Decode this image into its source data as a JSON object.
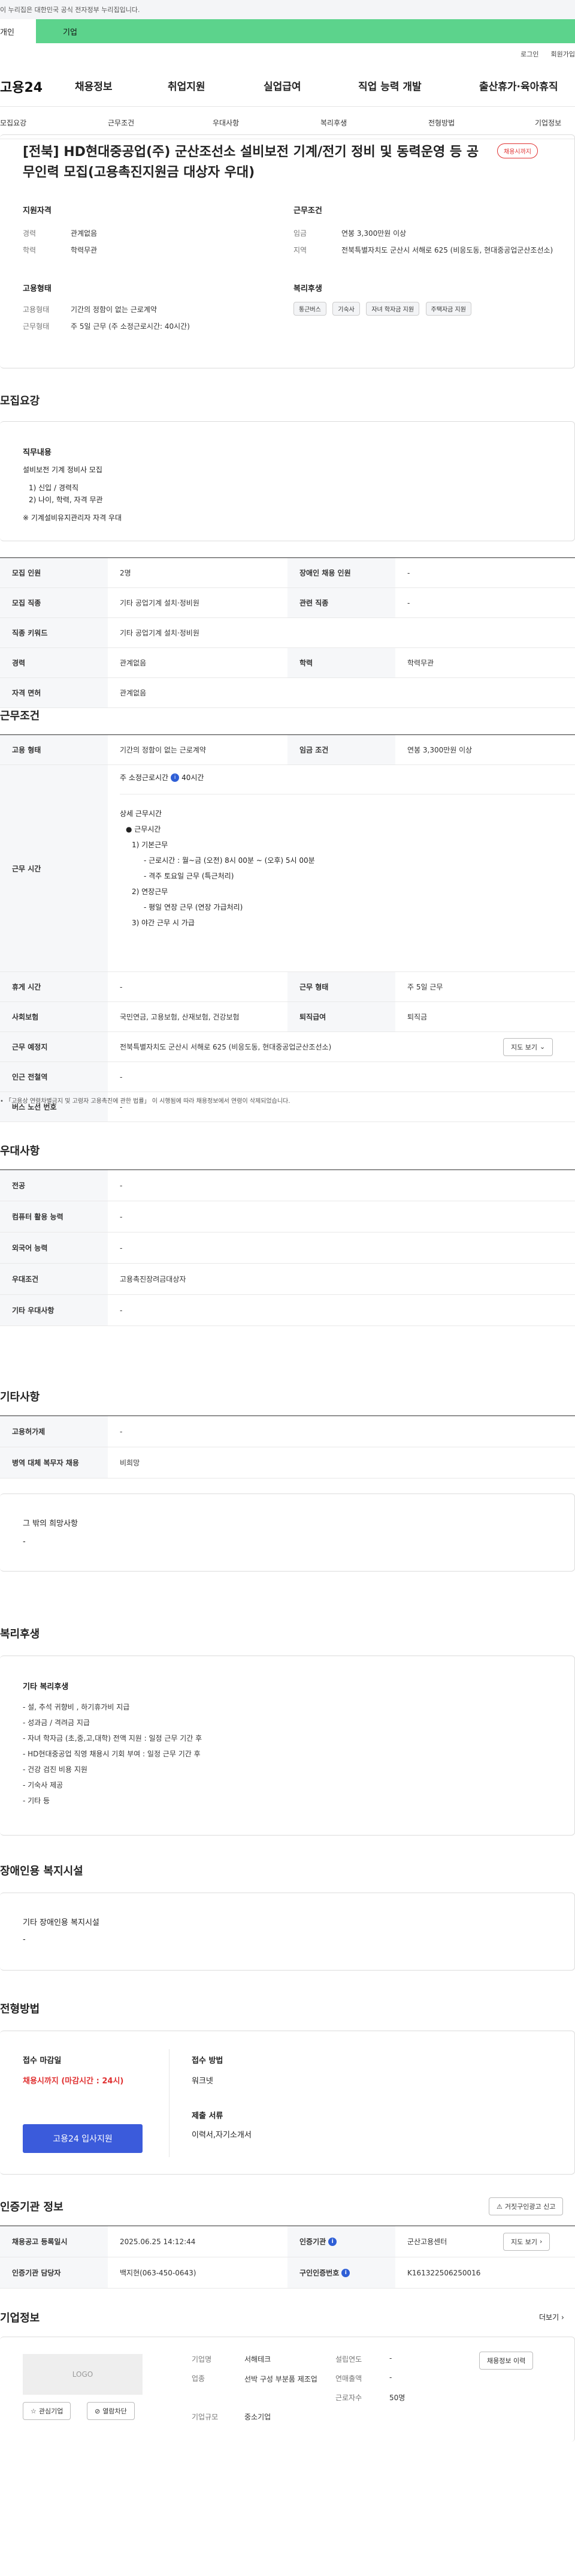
{
  "gov_banner": "이 누리집은 대한민국 공식 전자정부 누리집입니다.",
  "top_tabs": [
    "개인",
    "기업"
  ],
  "util": [
    "로그인",
    "회원가입"
  ],
  "logo": "고용24",
  "gnb": [
    "채용정보",
    "취업지원",
    "실업급여",
    "직업 능력 개발",
    "출산휴가·육아휴직"
  ],
  "lnb": [
    "모집요강",
    "근무조건",
    "우대사항",
    "복리후생",
    "전형방법",
    "기업정보"
  ],
  "header": {
    "title": "[전북] HD현대중공업(주) 군산조선소 설비보전 기계/전기 정비 및 동력운영 등 공무인력 모집(고용촉진지원금 대상자 우대)",
    "status": "채용시까지",
    "applicant_title": "지원자격",
    "applicant": [
      [
        "경력",
        "관계없음"
      ],
      [
        "학력",
        "학력무관"
      ]
    ],
    "emp_title": "고용형태",
    "emp": [
      [
        "고용형태",
        "기간의 정함이 없는 근로계약"
      ],
      [
        "근무형태",
        "주 5일 근무 (주 소정근로시간: 40시간)"
      ]
    ],
    "cond_title": "근무조건",
    "cond": [
      [
        "임금",
        "연봉 3,300만원 이상"
      ],
      [
        "지역",
        "전북특별자치도 군산시 서해로 625 (비응도동, 현대중공업군산조선소)"
      ]
    ],
    "welfare_title": "복리후생",
    "welfare_chips": [
      "통근버스",
      "기숙사",
      "자녀 학자금 지원",
      "주택자금 지원"
    ]
  },
  "recruit": {
    "title": "모집요강",
    "duty_label": "직무내용",
    "duty_lines": [
      "설비보전 기계 정비사 모집",
      "",
      "1) 신입 / 경력직",
      "2) 나이, 학력, 자격 무관",
      "",
      "※ 기계설비유지관리자 자격 우대"
    ],
    "rows": [
      [
        "모집 인원",
        "2명",
        "장애인 채용 인원",
        "-"
      ],
      [
        "모집 직종",
        "기타 공업기계 설치·정비원",
        "관련 직종",
        "-"
      ],
      [
        "직종 키워드",
        "기타 공업기계 설치·정비원",
        "",
        ""
      ],
      [
        "경력",
        "관계없음",
        "학력",
        "학력무관"
      ],
      [
        "자격 면허",
        "관계없음",
        "",
        ""
      ]
    ]
  },
  "work": {
    "title": "근무조건",
    "row1": [
      "고용 형태",
      "기간의 정함이 없는 근로계약",
      "임금 조건",
      "연봉 3,300만원 이상"
    ],
    "time_label": "근무 시간",
    "time_top": "주 소정근로시간",
    "time_hours": "40시간",
    "time_lines": [
      "상세 근무시간",
      "● 근무시간",
      "1) 기본근무",
      "- 근로시간 : 월~금 (오전) 8시 00분 ~ (오후) 5시 00분",
      "- 격주 토요일 근무 (특근처리)",
      "2) 연장근무",
      "- 평일 연장 근무 (연장 가급처리)",
      "3) 야간 근무 시 가급"
    ],
    "row3": [
      "휴게 시간",
      "-",
      "근무 형태",
      "주 5일 근무"
    ],
    "row4": [
      "사회보험",
      "국민연금, 고용보험, 산재보험, 건강보험",
      "퇴직급여",
      "퇴직금"
    ],
    "loc_label": "근무 예정지",
    "loc_value": "전북특별자치도 군산시 서해로 625 (비응도동, 현대중공업군산조선소)",
    "map_btn": "지도 보기",
    "row6": [
      "인근 전철역",
      "-"
    ],
    "row7": [
      "버스 노선 번호",
      "-"
    ],
    "note": "「고용상 연령차별금지 및 고령자 고용촉진에 관한 법률」 이 시행됨에 따라 채용정보에서 연령이 삭제되었습니다."
  },
  "prefer": {
    "title": "우대사항",
    "rows": [
      [
        "전공",
        "-"
      ],
      [
        "컴퓨터 활용 능력",
        "-"
      ],
      [
        "외국어 능력",
        "-"
      ],
      [
        "우대조건",
        "고용촉진장려금대상자"
      ],
      [
        "기타 우대사항",
        "-"
      ]
    ]
  },
  "etc": {
    "title": "기타사항",
    "rows": [
      [
        "고용허가제",
        "-"
      ],
      [
        "병역 대체 복무자 채용",
        "비희망"
      ]
    ],
    "other_title": "그 밖의 희망사항",
    "other_value": "-"
  },
  "benefit": {
    "title": "복리후생",
    "box_title": "기타 복리후생",
    "lines": [
      "- 설, 추석 귀향비 , 하기휴가비 지급",
      "- 성과금 / 격려금 지급",
      "- 자녀 학자금 (초,중,고,대학) 전액 지원 : 일정 근무 기간 후",
      "- HD현대중공업 직영 채용시 기회 부여 : 일정 근무 기간 후",
      "- 건강 검진 비용 지원",
      "- 기숙사 제공",
      "- 기타 등"
    ]
  },
  "disabled": {
    "title": "장애인용 복지시설",
    "box_title": "기타 장애인용 복지시설",
    "value": "-"
  },
  "selection": {
    "title": "전형방법",
    "deadline_label": "접수 마감일",
    "deadline_value": "채용시까지 (마감시간 : 24시)",
    "apply_btn": "고용24 입사지원",
    "method_label": "접수 방법",
    "method_value": "워크넷",
    "docs_label": "제출 서류",
    "docs_value": "이력서,자기소개서"
  },
  "agency": {
    "title": "인증기관 정보",
    "report_btn": "거짓구인광고 신고",
    "rows": [
      [
        "채용공고 등록일시",
        "2025.06.25 14:12:44",
        "인증기관",
        "군산고용센터"
      ],
      [
        "인증기관 담당자",
        "백지현(063-450-0643)",
        "구인인증번호",
        "K161322506250016"
      ]
    ],
    "map_btn": "지도 보기"
  },
  "company": {
    "title": "기업정보",
    "more": "더보기",
    "logo_label": "LOGO",
    "interest_btn": "관심기업",
    "block_btn": "열람차단",
    "fields": [
      [
        "기업명",
        "서해테크"
      ],
      [
        "업종",
        "선박 구성 부분품 제조업"
      ],
      [
        "기업규모",
        "중소기업"
      ]
    ],
    "fields2": [
      [
        "설립연도",
        "-"
      ],
      [
        "연매출액",
        "-"
      ],
      [
        "근로자수",
        "50명"
      ]
    ],
    "history_btn": "채용정보 이력"
  },
  "colors": {
    "accent": "#5cd38c",
    "primary": "#3b5bdb",
    "danger": "#e03131"
  }
}
